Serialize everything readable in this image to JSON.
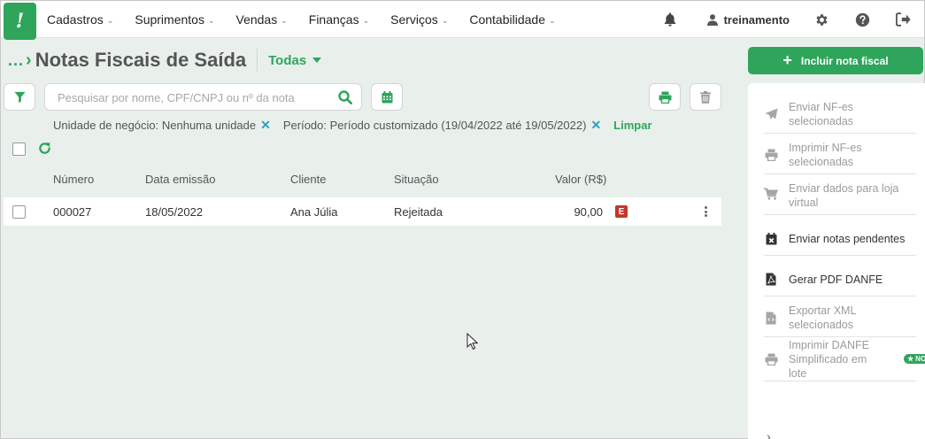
{
  "nav": {
    "logo": "!",
    "items": [
      {
        "label": "Cadastros"
      },
      {
        "label": "Suprimentos"
      },
      {
        "label": "Vendas"
      },
      {
        "label": "Finanças"
      },
      {
        "label": "Serviços"
      },
      {
        "label": "Contabilidade"
      }
    ],
    "user": "treinamento"
  },
  "header": {
    "breadcrumb": "...",
    "title": "Notas Fiscais de Saída",
    "filter_label": "Todas"
  },
  "search": {
    "placeholder": "Pesquisar por nome, CPF/CNPJ ou nº da nota"
  },
  "filters": {
    "chips": [
      {
        "label": "Unidade de negócio: Nenhuma unidade"
      },
      {
        "label": "Período: Período customizado (19/04/2022 até 19/05/2022)"
      }
    ],
    "clear_label": "Limpar"
  },
  "table": {
    "columns": [
      "Número",
      "Data emissão",
      "Cliente",
      "Situação",
      "Valor (R$)"
    ],
    "rows": [
      {
        "numero": "000027",
        "data": "18/05/2022",
        "cliente": "Ana Júlia",
        "situacao": "Rejeitada",
        "valor": "90,00",
        "badge": "E"
      }
    ]
  },
  "actions": {
    "incluir_label": "Incluir nota fiscal",
    "items": [
      {
        "label": "Enviar NF-es selecionadas",
        "icon": "send-icon",
        "enabled": false
      },
      {
        "label": "Imprimir NF-es selecionadas",
        "icon": "print-icon",
        "enabled": false
      },
      {
        "label": "Enviar dados para loja virtual",
        "icon": "cart-icon",
        "enabled": false
      },
      {
        "label": "Enviar notas pendentes",
        "icon": "calendar-x-icon",
        "enabled": true
      },
      {
        "label": "Gerar PDF DANFE",
        "icon": "pdf-icon",
        "enabled": true
      },
      {
        "label": "Exportar XML selecionados",
        "icon": "xml-file-icon",
        "enabled": false
      },
      {
        "label": "Imprimir DANFE Simplificado em lote",
        "icon": "print-icon",
        "enabled": false,
        "badge": "NOVO"
      }
    ]
  },
  "colors": {
    "brand": "#2ea55a",
    "background": "#e9f0ec",
    "danger": "#c0392b",
    "chip_close": "#2aa0c4"
  }
}
